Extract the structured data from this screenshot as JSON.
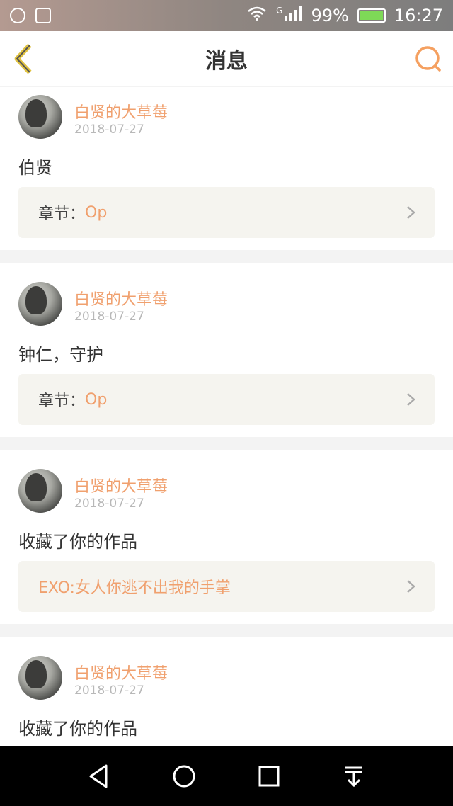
{
  "status_bar": {
    "signal_label": "G",
    "battery": "99%",
    "time": "16:27"
  },
  "app_bar": {
    "title": "消息"
  },
  "messages": [
    {
      "user": "白贤的大草莓",
      "date": "2018-07-27",
      "content": "伯贤",
      "ref_label": "章节：",
      "ref_value": "Op"
    },
    {
      "user": "白贤的大草莓",
      "date": "2018-07-27",
      "content": "钟仁，守护",
      "ref_label": "章节：",
      "ref_value": "Op"
    },
    {
      "user": "白贤的大草莓",
      "date": "2018-07-27",
      "content": "收藏了你的作品",
      "ref_label": "",
      "ref_value": "EXO:女人你逃不出我的手掌"
    },
    {
      "user": "白贤的大草莓",
      "date": "2018-07-27",
      "content": "收藏了你的作品"
    }
  ],
  "colors": {
    "accent": "#f0a06e",
    "back_icon": "#e0c240",
    "search_icon": "#f5a060"
  }
}
